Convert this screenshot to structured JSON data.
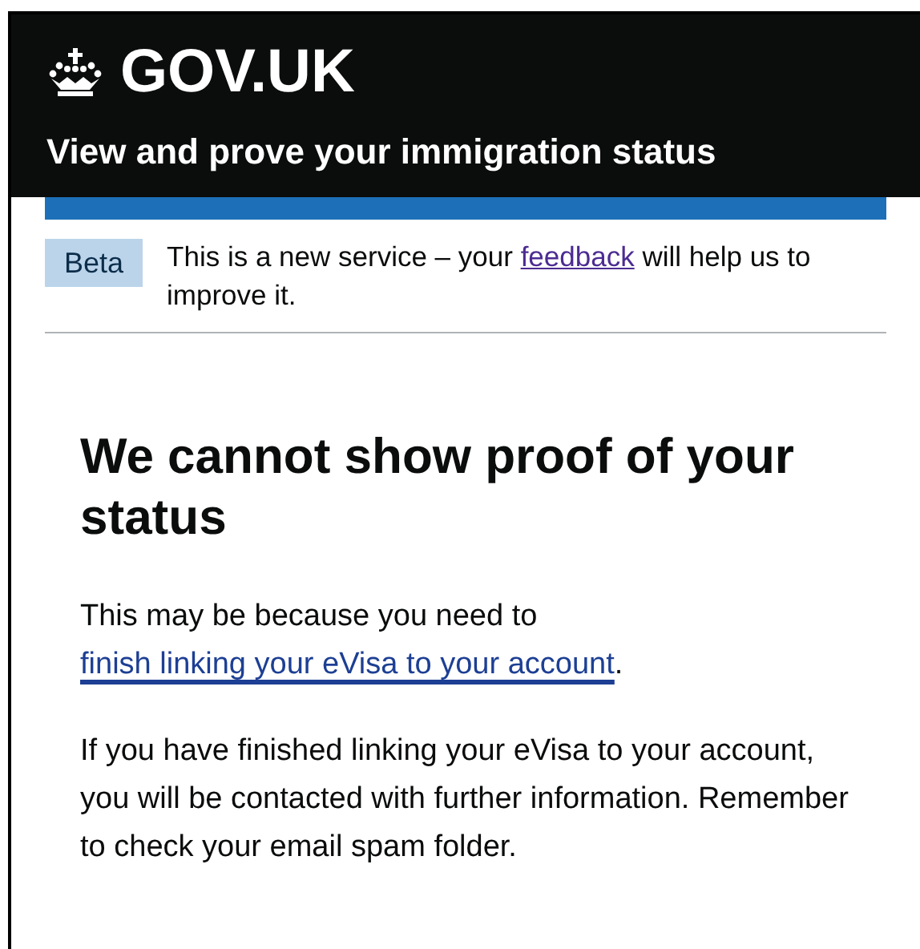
{
  "header": {
    "logo_text": "GOV.UK",
    "service_name": "View and prove your immigration status"
  },
  "phase_banner": {
    "tag": "Beta",
    "text_before": "This is a new service – your ",
    "link": "feedback",
    "text_after": " will help us to improve it."
  },
  "heading": "We cannot show proof of your status",
  "paragraphs": [
    {
      "text_before": "This may be because you need to ",
      "link": "finish linking your eVisa to your account",
      "text_after": "."
    },
    {
      "text_before": "If you have finished linking your eVisa to your account, you will be contacted with further information. Remember to check your email spam folder."
    }
  ]
}
